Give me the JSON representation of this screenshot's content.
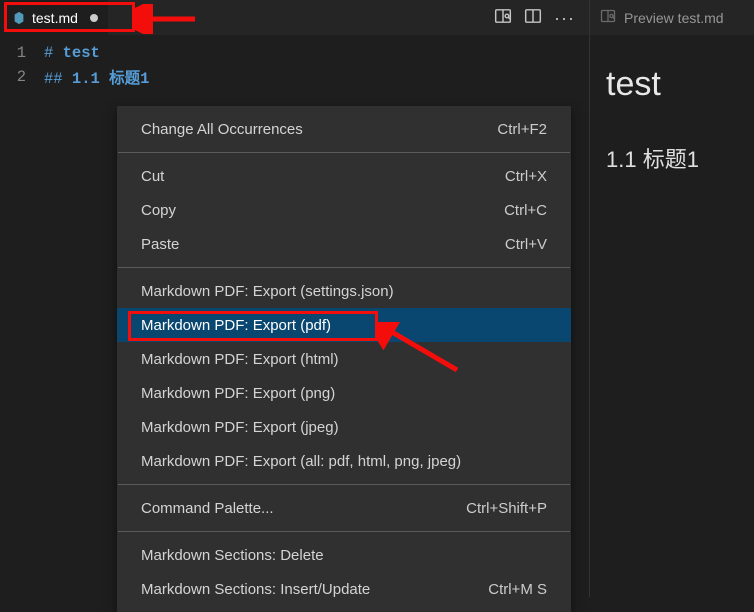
{
  "tab": {
    "filename": "test.md"
  },
  "editor": {
    "lines": [
      {
        "num": "1",
        "prefix": "# ",
        "text": "test"
      },
      {
        "num": "2",
        "prefix": "## ",
        "text": "1.1 标题1"
      }
    ]
  },
  "contextMenu": {
    "items": [
      {
        "label": "Change All Occurrences",
        "shortcut": "Ctrl+F2"
      }
    ],
    "clipboard": [
      {
        "label": "Cut",
        "shortcut": "Ctrl+X"
      },
      {
        "label": "Copy",
        "shortcut": "Ctrl+C"
      },
      {
        "label": "Paste",
        "shortcut": "Ctrl+V"
      }
    ],
    "export": [
      {
        "label": "Markdown PDF: Export (settings.json)",
        "shortcut": ""
      },
      {
        "label": "Markdown PDF: Export (pdf)",
        "shortcut": "",
        "highlight": true
      },
      {
        "label": "Markdown PDF: Export (html)",
        "shortcut": ""
      },
      {
        "label": "Markdown PDF: Export (png)",
        "shortcut": ""
      },
      {
        "label": "Markdown PDF: Export (jpeg)",
        "shortcut": ""
      },
      {
        "label": "Markdown PDF: Export (all: pdf, html, png, jpeg)",
        "shortcut": ""
      }
    ],
    "palette": [
      {
        "label": "Command Palette...",
        "shortcut": "Ctrl+Shift+P"
      }
    ],
    "sections": [
      {
        "label": "Markdown Sections: Delete",
        "shortcut": ""
      },
      {
        "label": "Markdown Sections: Insert/Update",
        "shortcut": "Ctrl+M S"
      }
    ]
  },
  "preview": {
    "tabTitle": "Preview test.md",
    "h1": "test",
    "h2": "1.1 标题1"
  }
}
